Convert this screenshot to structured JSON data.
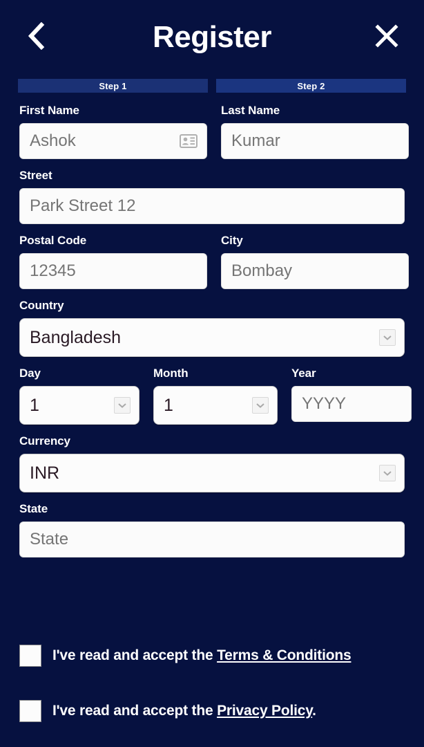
{
  "header": {
    "title": "Register",
    "back_icon": "chevron-left-icon",
    "close_icon": "close-x-icon"
  },
  "steps": [
    {
      "label": "Step 1",
      "active": true
    },
    {
      "label": "Step 2",
      "active": false
    }
  ],
  "form": {
    "first_name": {
      "label": "First Name",
      "value": "",
      "placeholder": "Ashok",
      "icon": "contact-card-icon"
    },
    "last_name": {
      "label": "Last Name",
      "value": "",
      "placeholder": "Kumar"
    },
    "street": {
      "label": "Street",
      "value": "",
      "placeholder": "Park Street 12"
    },
    "postal_code": {
      "label": "Postal Code",
      "value": "",
      "placeholder": "12345"
    },
    "city": {
      "label": "City",
      "value": "",
      "placeholder": "Bombay"
    },
    "country": {
      "label": "Country",
      "selected": "Bangladesh"
    },
    "day": {
      "label": "Day",
      "selected": "1"
    },
    "month": {
      "label": "Month",
      "selected": "1"
    },
    "year": {
      "label": "Year",
      "value": "",
      "placeholder": "YYYY"
    },
    "currency": {
      "label": "Currency",
      "selected": "INR"
    },
    "state": {
      "label": "State",
      "value": "",
      "placeholder": "State"
    }
  },
  "agreements": [
    {
      "text": "I've read and accept the ",
      "link": "Terms & Conditions",
      "suffix": "",
      "checked": false
    },
    {
      "text": "I've read and accept the ",
      "link": "Privacy Policy",
      "suffix": ".",
      "checked": false
    }
  ],
  "colors": {
    "background": "#061140",
    "step_active": "#1b3175",
    "step_inactive": "#1b3580",
    "field_background": "#fbfbfb",
    "text_light": "#ffffff",
    "placeholder": "#c3c3c3"
  }
}
